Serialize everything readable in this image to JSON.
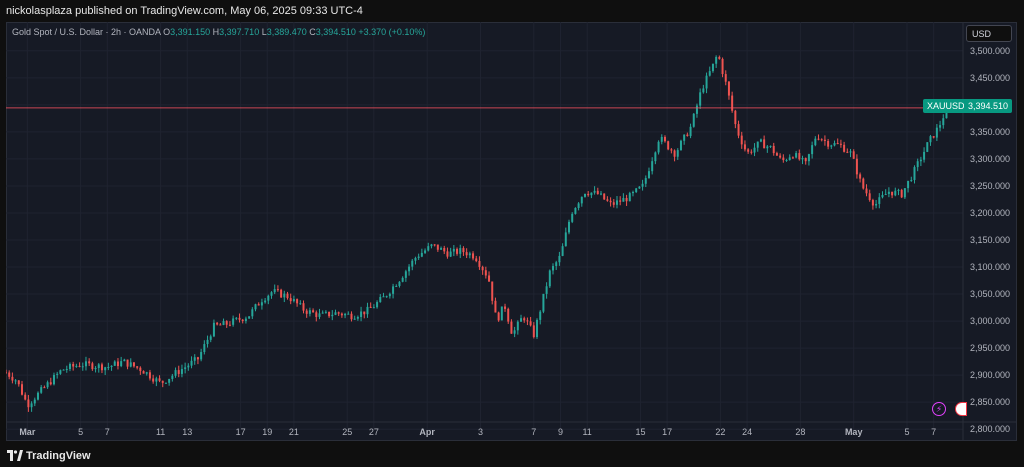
{
  "header": {
    "published": "nickolasplaza published on TradingView.com, May 06, 2025 09:33 UTC-4"
  },
  "legend": {
    "symbol": "Gold Spot / U.S. Dollar · 2h · OANDA",
    "o_label": "O",
    "o_value": "3,391.150",
    "h_label": "H",
    "h_value": "3,397.710",
    "l_label": "L",
    "l_value": "3,389.470",
    "c_label": "C",
    "c_value": "3,394.510",
    "change": "+3.370 (+0.10%)"
  },
  "currency": "USD",
  "ticker_label": "XAUUSD",
  "last_price_label": "3,394.510",
  "footer": {
    "brand": "TradingView"
  },
  "colors": {
    "up": "#26a69a",
    "down": "#ef5350",
    "background": "#161a25",
    "grid": "#1f2330",
    "price_line": "#f7525f"
  },
  "icons": [
    "lightning-icon",
    "us-flag-icon",
    "tradingview-logo-icon"
  ],
  "chart_data": {
    "type": "candlestick",
    "title": "Gold Spot / U.S. Dollar · 2h · OANDA",
    "ylim": [
      2780,
      3520
    ],
    "y_ticks": [
      2800,
      2850,
      2900,
      2950,
      3000,
      3050,
      3100,
      3150,
      3200,
      3250,
      3300,
      3350,
      3400,
      3450,
      3500
    ],
    "y_tick_labels": [
      "2,800.000",
      "2,850.000",
      "2,900.000",
      "2,950.000",
      "3,000.000",
      "3,050.000",
      "3,100.000",
      "3,150.000",
      "3,200.000",
      "3,250.000",
      "3,300.000",
      "3,350.000",
      "3,400.000",
      "3,450.000",
      "3,500.000"
    ],
    "x_tick_labels": [
      "Mar",
      "5",
      "7",
      "11",
      "13",
      "17",
      "19",
      "21",
      "25",
      "27",
      "Apr",
      "3",
      "7",
      "9",
      "11",
      "15",
      "17",
      "22",
      "24",
      "28",
      "May",
      "5",
      "7"
    ],
    "x_tick_bold": [
      true,
      false,
      false,
      false,
      false,
      false,
      false,
      false,
      false,
      false,
      true,
      false,
      false,
      false,
      false,
      false,
      false,
      false,
      false,
      false,
      true,
      false,
      false
    ],
    "x_tick_index": [
      0,
      2,
      3,
      5,
      6,
      8,
      9,
      10,
      12,
      13,
      15,
      17,
      19,
      20,
      21,
      23,
      24,
      26,
      27,
      29,
      31,
      33,
      34
    ],
    "x_range": [
      -0.8,
      35.1
    ],
    "grid": true,
    "last_price": 3394.51,
    "price_path": [
      [
        -0.8,
        2905
      ],
      [
        -0.4,
        2890
      ],
      [
        0.0,
        2845
      ],
      [
        0.3,
        2860
      ],
      [
        0.8,
        2885
      ],
      [
        1.3,
        2910
      ],
      [
        2.0,
        2920
      ],
      [
        3.0,
        2915
      ],
      [
        3.6,
        2925
      ],
      [
        4.3,
        2910
      ],
      [
        5.0,
        2885
      ],
      [
        5.6,
        2905
      ],
      [
        6.4,
        2930
      ],
      [
        7.0,
        2990
      ],
      [
        7.5,
        2995
      ],
      [
        8.3,
        3010
      ],
      [
        8.8,
        3040
      ],
      [
        9.2,
        3055
      ],
      [
        9.8,
        3045
      ],
      [
        10.4,
        3020
      ],
      [
        11.0,
        3010
      ],
      [
        11.6,
        3015
      ],
      [
        12.2,
        3010
      ],
      [
        12.8,
        3020
      ],
      [
        13.4,
        3045
      ],
      [
        14.0,
        3080
      ],
      [
        14.6,
        3120
      ],
      [
        15.2,
        3140
      ],
      [
        15.8,
        3125
      ],
      [
        16.3,
        3130
      ],
      [
        16.8,
        3120
      ],
      [
        17.3,
        3080
      ],
      [
        17.6,
        3000
      ],
      [
        17.9,
        3030
      ],
      [
        18.2,
        2975
      ],
      [
        18.6,
        3010
      ],
      [
        19.0,
        2975
      ],
      [
        19.6,
        3090
      ],
      [
        20.0,
        3120
      ],
      [
        20.4,
        3200
      ],
      [
        20.9,
        3240
      ],
      [
        21.4,
        3235
      ],
      [
        21.9,
        3215
      ],
      [
        22.6,
        3230
      ],
      [
        23.1,
        3250
      ],
      [
        23.7,
        3340
      ],
      [
        24.3,
        3310
      ],
      [
        24.9,
        3360
      ],
      [
        25.3,
        3430
      ],
      [
        25.7,
        3470
      ],
      [
        25.9,
        3495
      ],
      [
        26.2,
        3440
      ],
      [
        26.6,
        3355
      ],
      [
        27.0,
        3310
      ],
      [
        27.5,
        3330
      ],
      [
        27.9,
        3320
      ],
      [
        28.3,
        3295
      ],
      [
        28.7,
        3310
      ],
      [
        29.2,
        3290
      ],
      [
        29.6,
        3345
      ],
      [
        30.0,
        3330
      ],
      [
        30.5,
        3325
      ],
      [
        30.9,
        3310
      ],
      [
        31.3,
        3250
      ],
      [
        31.8,
        3215
      ],
      [
        32.3,
        3240
      ],
      [
        32.8,
        3235
      ],
      [
        33.3,
        3280
      ],
      [
        33.8,
        3330
      ],
      [
        34.2,
        3360
      ],
      [
        34.5,
        3395
      ]
    ]
  }
}
